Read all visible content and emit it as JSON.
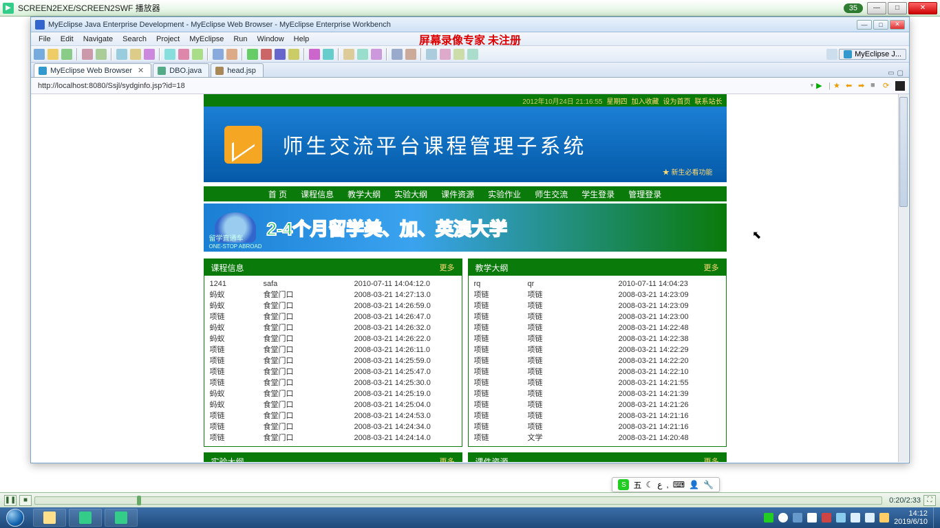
{
  "player": {
    "title": "SCREEN2EXE/SCREEN2SWF 播放器",
    "badge": "35",
    "time": "0:20/2:33"
  },
  "eclipse": {
    "title": "MyEclipse Java Enterprise Development - MyEclipse Web Browser - MyEclipse Enterprise Workbench",
    "menu": [
      "File",
      "Edit",
      "Navigate",
      "Search",
      "Project",
      "MyEclipse",
      "Run",
      "Window",
      "Help"
    ],
    "overlay": "屏幕录像专家  未注册",
    "perspective": "MyEclipse J...",
    "tabs": [
      {
        "label": "MyEclipse Web Browser",
        "active": true,
        "closable": true
      },
      {
        "label": "DBO.java",
        "active": false,
        "closable": false
      },
      {
        "label": "head.jsp",
        "active": false,
        "closable": false
      }
    ],
    "url": "http://localhost:8080/Ssjl/sydginfo.jsp?id=18"
  },
  "site": {
    "topbar": {
      "date": "2012年10月24日 21:16:55",
      "day": "星期四",
      "links": [
        "加入收藏",
        "设为首页",
        "联系站长"
      ]
    },
    "banner_title": "师生交流平台课程管理子系统",
    "banner_note": "★ 新生必看功能",
    "nav": [
      "首 页",
      "课程信息",
      "教学大纲",
      "实验大纲",
      "课件资源",
      "实验作业",
      "师生交流",
      "学生登录",
      "管理登录"
    ],
    "ad_text": "2-4个月留学美、加、英澳大学",
    "ad_sub": "留学直通车",
    "ad_sub2": "ONE-STOP ABROAD",
    "panel_more": "更多",
    "left": {
      "title": "课程信息",
      "rows": [
        {
          "c1": "1241",
          "c2": "safa",
          "c3": "2010-07-11 14:04:12.0"
        },
        {
          "c1": "蚂蚁",
          "c2": "食堂门口",
          "c3": "2008-03-21 14:27:13.0"
        },
        {
          "c1": "蚂蚁",
          "c2": "食堂门口",
          "c3": "2008-03-21 14:26:59.0"
        },
        {
          "c1": "项链",
          "c2": "食堂门口",
          "c3": "2008-03-21 14:26:47.0"
        },
        {
          "c1": "蚂蚁",
          "c2": "食堂门口",
          "c3": "2008-03-21 14:26:32.0"
        },
        {
          "c1": "蚂蚁",
          "c2": "食堂门口",
          "c3": "2008-03-21 14:26:22.0"
        },
        {
          "c1": "项链",
          "c2": "食堂门口",
          "c3": "2008-03-21 14:26:11.0"
        },
        {
          "c1": "项链",
          "c2": "食堂门口",
          "c3": "2008-03-21 14:25:59.0"
        },
        {
          "c1": "项链",
          "c2": "食堂门口",
          "c3": "2008-03-21 14:25:47.0"
        },
        {
          "c1": "项链",
          "c2": "食堂门口",
          "c3": "2008-03-21 14:25:30.0"
        },
        {
          "c1": "蚂蚁",
          "c2": "食堂门口",
          "c3": "2008-03-21 14:25:19.0"
        },
        {
          "c1": "蚂蚁",
          "c2": "食堂门口",
          "c3": "2008-03-21 14:25:04.0"
        },
        {
          "c1": "项链",
          "c2": "食堂门口",
          "c3": "2008-03-21 14:24:53.0"
        },
        {
          "c1": "项链",
          "c2": "食堂门口",
          "c3": "2008-03-21 14:24:34.0"
        },
        {
          "c1": "项链",
          "c2": "食堂门口",
          "c3": "2008-03-21 14:24:14.0"
        }
      ]
    },
    "right": {
      "title": "教学大纲",
      "rows": [
        {
          "c1": "rq",
          "c2": "qr",
          "c3": "2010-07-11 14:04:23"
        },
        {
          "c1": "项链",
          "c2": "项链",
          "c3": "2008-03-21 14:23:09"
        },
        {
          "c1": "项链",
          "c2": "项链",
          "c3": "2008-03-21 14:23:09"
        },
        {
          "c1": "项链",
          "c2": "项链",
          "c3": "2008-03-21 14:23:00"
        },
        {
          "c1": "项链",
          "c2": "项链",
          "c3": "2008-03-21 14:22:48"
        },
        {
          "c1": "项链",
          "c2": "项链",
          "c3": "2008-03-21 14:22:38"
        },
        {
          "c1": "项链",
          "c2": "项链",
          "c3": "2008-03-21 14:22:29"
        },
        {
          "c1": "项链",
          "c2": "项链",
          "c3": "2008-03-21 14:22:20"
        },
        {
          "c1": "项链",
          "c2": "项链",
          "c3": "2008-03-21 14:22:10"
        },
        {
          "c1": "项链",
          "c2": "项链",
          "c3": "2008-03-21 14:21:55"
        },
        {
          "c1": "项链",
          "c2": "项链",
          "c3": "2008-03-21 14:21:39"
        },
        {
          "c1": "项链",
          "c2": "项链",
          "c3": "2008-03-21 14:21:26"
        },
        {
          "c1": "项链",
          "c2": "项链",
          "c3": "2008-03-21 14:21:16"
        },
        {
          "c1": "项链",
          "c2": "项链",
          "c3": "2008-03-21 14:21:16"
        },
        {
          "c1": "项链",
          "c2": "文学",
          "c3": "2008-03-21 14:20:48"
        }
      ]
    },
    "bottom_left_title": "实验大纲",
    "bottom_right_title": "课件资源"
  },
  "ime": {
    "label": "五",
    "icons": [
      "☾",
      "ع",
      ",",
      "⌨",
      "👤",
      "🔧"
    ]
  },
  "taskbar": {
    "time": "14:12",
    "date": "2019/6/10"
  }
}
